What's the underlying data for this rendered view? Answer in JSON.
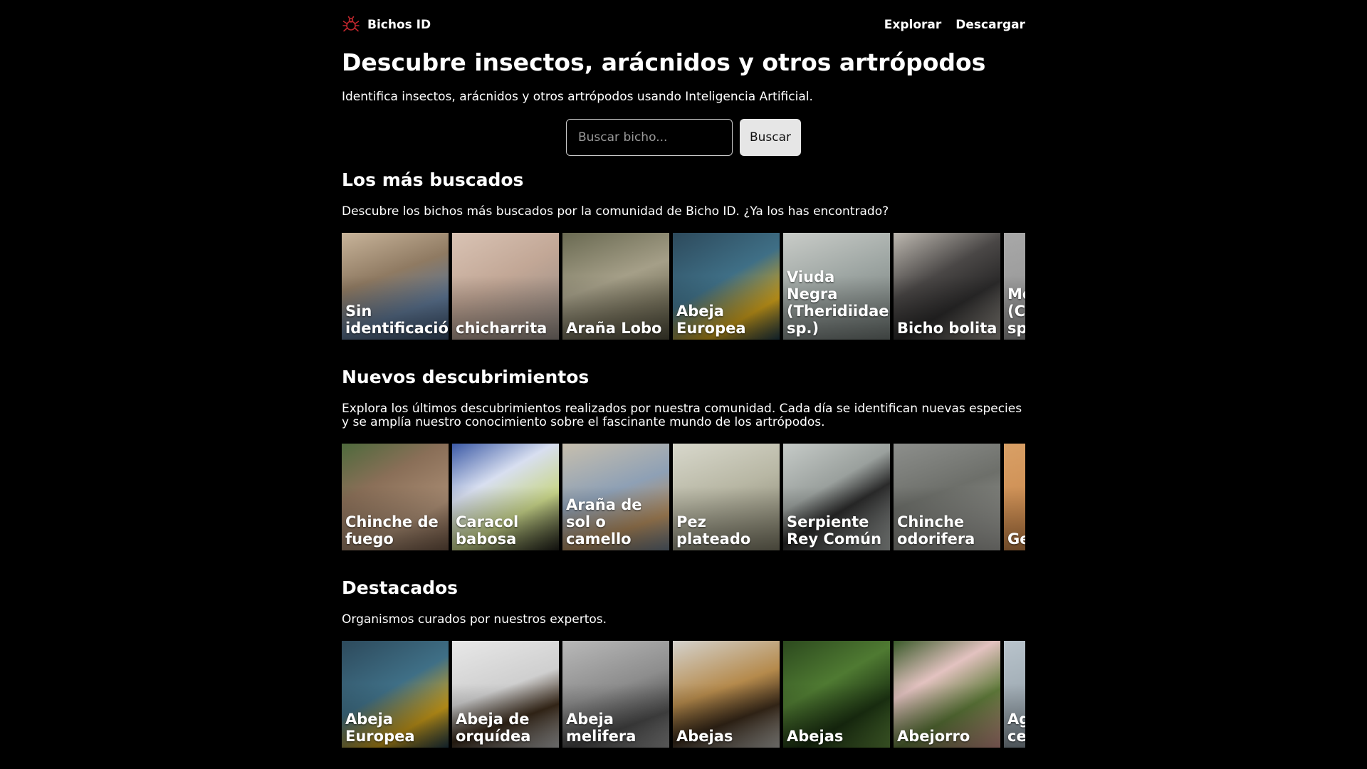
{
  "header": {
    "brand": "Bichos ID",
    "nav": [
      {
        "label": "Explorar"
      },
      {
        "label": "Descargar"
      }
    ]
  },
  "hero": {
    "title": "Descubre insectos, arácnidos y otros artrópodos",
    "subtitle": "Identifica insectos, arácnidos y otros artrópodos usando Inteligencia Artificial."
  },
  "search": {
    "placeholder": "Buscar bicho...",
    "button_label": "Buscar"
  },
  "sections": [
    {
      "title": "Los más buscados",
      "description": "Descubre los bichos más buscados por la comunidad de Bicho ID. ¿Ya los has encontrado?",
      "cards": [
        {
          "label": "Sin identificación",
          "bg": "linear-gradient(160deg,#c8b49a 0%,#8f7a62 40%,#5d7592 70%,#3a4f6a 100%)"
        },
        {
          "label": "chicharrita",
          "bg": "linear-gradient(150deg,#d9c3b4 0%,#c2a796 45%,#8f8680 100%)"
        },
        {
          "label": "Araña Lobo",
          "bg": "linear-gradient(160deg,#6a6a52 0%,#a59f88 45%,#7b7660 70%,#4d4b3a 100%)"
        },
        {
          "label": "Abeja Europea",
          "bg": "linear-gradient(150deg,#2d4a5c 0%,#3f6f86 45%,#d1a21b 75%,#1f3a48 100%)"
        },
        {
          "label": "Viuda Negra (Theridiidae sp.)",
          "bg": "linear-gradient(160deg,#c9ccc8 0%,#9ea6a3 45%,#6e7673 100%)"
        },
        {
          "label": "Bicho bolita",
          "bg": "linear-gradient(150deg,#bdb8b0 0%,#4a4746 40%,#2b2a2a 65%,#9c978f 100%)"
        },
        {
          "label": "Mosca (Calliphoridae sp.)",
          "bg": "linear-gradient(160deg,#a8a8a8 0%,#8a8a8a 100%)"
        }
      ]
    },
    {
      "title": "Nuevos descubrimientos",
      "description": "Explora los últimos descubrimientos realizados por nuestra comunidad. Cada día se identifican nuevas especies y se amplía nuestro conocimiento sobre el fascinante mundo de los artrópodos.",
      "cards": [
        {
          "label": "Chinche de fuego",
          "bg": "linear-gradient(150deg,#4e6a3c 0%,#8a6f58 35%,#a88b72 70%,#6d5443 100%)"
        },
        {
          "label": "Caracol babosa",
          "bg": "linear-gradient(150deg,#3c5aa6 0%,#d8dff0 35%,#c9d68a 65%,#1f1f1a 100%)"
        },
        {
          "label": "Araña de sol o camello",
          "bg": "linear-gradient(160deg,#c7bfae 0%,#8ea0b5 45%,#b08a5c 75%,#6b7a8a 100%)"
        },
        {
          "label": "Pez plateado",
          "bg": "linear-gradient(160deg,#d8d8cc 0%,#b8b7a4 45%,#7d7a66 100%)"
        },
        {
          "label": "Serpiente Rey Común",
          "bg": "linear-gradient(150deg,#c6cbc8 0%,#9aa09d 40%,#2a2a2a 60%,#aeb3b0 100%)"
        },
        {
          "label": "Chinche odorifera",
          "bg": "linear-gradient(160deg,#8d8f8c 0%,#6d6f6a 45%,#a5a5a0 100%)"
        },
        {
          "label": "Gecko",
          "bg": "linear-gradient(160deg,#d9a066 0%,#c07a3e 100%)"
        }
      ]
    },
    {
      "title": "Destacados",
      "description": "Organismos curados por nuestros expertos.",
      "cards": [
        {
          "label": "Abeja Europea",
          "bg": "linear-gradient(150deg,#2d4a5c 0%,#3f6f86 45%,#d1a21b 75%,#1f3a48 100%)"
        },
        {
          "label": "Abeja de orquídea",
          "bg": "linear-gradient(160deg,#e8e8e8 0%,#cfcfcf 45%,#3a2a1a 70%,#bdbdbd 100%)"
        },
        {
          "label": "Abeja melifera",
          "bg": "linear-gradient(160deg,#b9b9b9 0%,#8d8d8d 45%,#4b4b4b 75%,#9c9c9c 100%)"
        },
        {
          "label": "Abejas",
          "bg": "linear-gradient(160deg,#d4d2cd 0%,#b58a4c 45%,#3a2a1a 70%,#bcbab4 100%)"
        },
        {
          "label": "Abejas",
          "bg": "linear-gradient(150deg,#2c4a1e 0%,#4f7a32 40%,#1c3312 70%,#5f8a3c 100%)"
        },
        {
          "label": "Abejorro",
          "bg": "linear-gradient(150deg,#3a5a2a 0%,#e3c2c0 35%,#5f7a3a 65%,#c98f88 100%)"
        },
        {
          "label": "Agave centenario",
          "bg": "linear-gradient(160deg,#b9c4cc 0%,#7d8a93 100%)"
        }
      ]
    }
  ],
  "colors": {
    "background": "#000000",
    "text": "#ffffff",
    "brand_icon": "#c0262d",
    "button_bg": "#e6e6e6"
  }
}
